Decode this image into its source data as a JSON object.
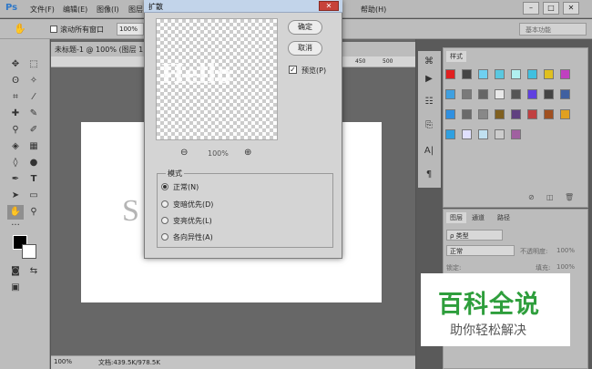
{
  "app": {
    "logo": "Ps"
  },
  "menubar": {
    "items": [
      "文件(F)",
      "编辑(E)",
      "图像(I)",
      "图层",
      "帮助(H)"
    ],
    "window_buttons": [
      "–",
      "□",
      "✕"
    ]
  },
  "optionsbar": {
    "scroll_all_label": "滚动所有窗口",
    "zoom_value": "100%",
    "workspace": "基本功能"
  },
  "document": {
    "tab_title": "未标题-1 @ 100% (图层 1, R",
    "ruler_marks": [
      "450",
      "500"
    ],
    "status_zoom": "100%",
    "status_doc": "文档:439.5K/978.5K",
    "canvas_text": "S"
  },
  "dialog": {
    "title": "扩散",
    "ok_label": "确定",
    "cancel_label": "取消",
    "preview_label": "预览(P)",
    "preview_zoom": "100%",
    "zoom_out": "⊖",
    "zoom_in": "⊕",
    "preview_text": "Hello",
    "mode_group_label": "模式",
    "modes": [
      {
        "label": "正常(N)",
        "selected": true
      },
      {
        "label": "变暗优先(D)",
        "selected": false
      },
      {
        "label": "变亮优先(L)",
        "selected": false
      },
      {
        "label": "各向异性(A)",
        "selected": false
      }
    ]
  },
  "swatch_panel": {
    "tab": "样式",
    "colors": [
      [
        "#e02020",
        "#444",
        "#6fd0f0",
        "#5ac8e0",
        "#b0f0f0",
        "#40c0e0",
        "#e0c020",
        "#c040c0",
        "#40a0e0",
        "#7a7a7a",
        "#666",
        "#e8e8e8",
        "#555",
        "#6040e0",
        "#444",
        "#4060a0",
        "#3090e0",
        "#6a6a6a",
        "#888",
        "#806020",
        "#604080",
        "#c04040",
        "#a05020",
        "#e0a020",
        "#30a0e0",
        "#e0e0ff",
        "#c0e0f0",
        "#ccc",
        "#a060a0"
      ]
    ]
  },
  "layers_panel": {
    "tabs": [
      "图层",
      "通道",
      "路径"
    ],
    "kind_label": "ρ 类型",
    "blend_mode": "正常",
    "opacity_label": "不透明度:",
    "opacity_value": "100%",
    "lock_label": "锁定:",
    "fill_label": "填充:",
    "fill_value": "100%"
  },
  "watermark": {
    "line1": "百科全说",
    "line2": "助你轻松解决"
  },
  "colors": {
    "watermark_green": "#2e9e3c",
    "dialog_bg": "#d4d4d4",
    "panel_bg": "#bcbcbc"
  }
}
